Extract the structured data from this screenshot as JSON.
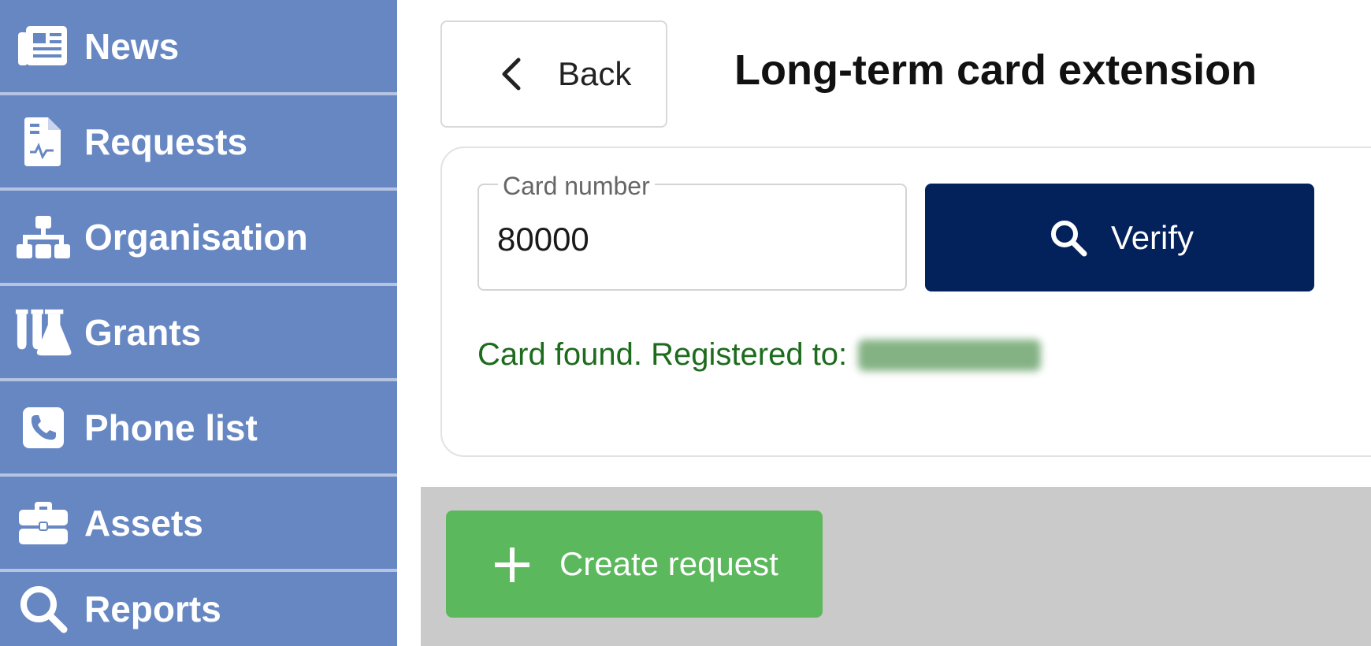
{
  "sidebar": {
    "items": [
      {
        "label": "News",
        "icon": "newspaper-icon"
      },
      {
        "label": "Requests",
        "icon": "document-icon"
      },
      {
        "label": "Organisation",
        "icon": "org-chart-icon"
      },
      {
        "label": "Grants",
        "icon": "flask-icon"
      },
      {
        "label": "Phone list",
        "icon": "phone-icon"
      },
      {
        "label": "Assets",
        "icon": "briefcase-icon"
      },
      {
        "label": "Reports",
        "icon": "search-icon"
      }
    ],
    "background": "#6787c3"
  },
  "header": {
    "back_label": "Back",
    "title": "Long-term card extension"
  },
  "form": {
    "card_number_label": "Card number",
    "card_number_value": "80000",
    "verify_label": "Verify",
    "status_text": "Card found. Registered to:"
  },
  "actions": {
    "create_label": "Create request"
  },
  "colors": {
    "verify": "#03215a",
    "create": "#5cb85c",
    "status": "#1d6b1d"
  }
}
